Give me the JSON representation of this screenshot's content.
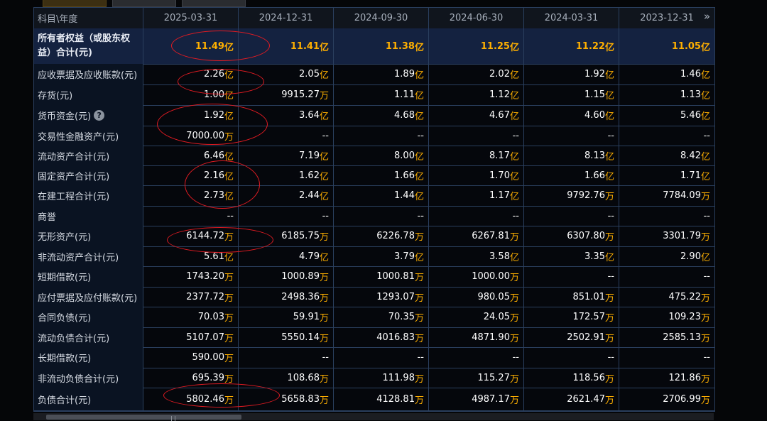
{
  "header": {
    "label": "科目\\年度",
    "periods": [
      "2025-03-31",
      "2024-12-31",
      "2024-09-30",
      "2024-06-30",
      "2024-03-31",
      "2023-12-31"
    ],
    "more_icon": "double-chevron-right-icon"
  },
  "rows": [
    {
      "label": "所有者权益（或股东权益）合计(元)",
      "values": [
        {
          "n": "11.49",
          "u": "亿"
        },
        {
          "n": "11.41",
          "u": "亿"
        },
        {
          "n": "11.38",
          "u": "亿"
        },
        {
          "n": "11.25",
          "u": "亿"
        },
        {
          "n": "11.22",
          "u": "亿"
        },
        {
          "n": "11.05",
          "u": "亿"
        }
      ]
    },
    {
      "label": "应收票据及应收账款(元)",
      "values": [
        {
          "n": "2.26",
          "u": "亿"
        },
        {
          "n": "2.05",
          "u": "亿"
        },
        {
          "n": "1.89",
          "u": "亿"
        },
        {
          "n": "2.02",
          "u": "亿"
        },
        {
          "n": "1.92",
          "u": "亿"
        },
        {
          "n": "1.46",
          "u": "亿"
        }
      ]
    },
    {
      "label": "存货(元)",
      "values": [
        {
          "n": "1.00",
          "u": "亿"
        },
        {
          "n": "9915.27",
          "u": "万"
        },
        {
          "n": "1.11",
          "u": "亿"
        },
        {
          "n": "1.12",
          "u": "亿"
        },
        {
          "n": "1.15",
          "u": "亿"
        },
        {
          "n": "1.13",
          "u": "亿"
        }
      ]
    },
    {
      "label": "货币资金(元)",
      "help": "?",
      "values": [
        {
          "n": "1.92",
          "u": "亿"
        },
        {
          "n": "3.64",
          "u": "亿"
        },
        {
          "n": "4.68",
          "u": "亿"
        },
        {
          "n": "4.67",
          "u": "亿"
        },
        {
          "n": "4.60",
          "u": "亿"
        },
        {
          "n": "5.46",
          "u": "亿"
        }
      ]
    },
    {
      "label": "交易性金融资产(元)",
      "values": [
        {
          "n": "7000.00",
          "u": "万"
        },
        {
          "n": "--",
          "u": ""
        },
        {
          "n": "--",
          "u": ""
        },
        {
          "n": "--",
          "u": ""
        },
        {
          "n": "--",
          "u": ""
        },
        {
          "n": "--",
          "u": ""
        }
      ]
    },
    {
      "label": "流动资产合计(元)",
      "values": [
        {
          "n": "6.46",
          "u": "亿"
        },
        {
          "n": "7.19",
          "u": "亿"
        },
        {
          "n": "8.00",
          "u": "亿"
        },
        {
          "n": "8.17",
          "u": "亿"
        },
        {
          "n": "8.13",
          "u": "亿"
        },
        {
          "n": "8.42",
          "u": "亿"
        }
      ]
    },
    {
      "label": "固定资产合计(元)",
      "values": [
        {
          "n": "2.16",
          "u": "亿"
        },
        {
          "n": "1.62",
          "u": "亿"
        },
        {
          "n": "1.66",
          "u": "亿"
        },
        {
          "n": "1.70",
          "u": "亿"
        },
        {
          "n": "1.66",
          "u": "亿"
        },
        {
          "n": "1.71",
          "u": "亿"
        }
      ]
    },
    {
      "label": "在建工程合计(元)",
      "values": [
        {
          "n": "2.73",
          "u": "亿"
        },
        {
          "n": "2.44",
          "u": "亿"
        },
        {
          "n": "1.44",
          "u": "亿"
        },
        {
          "n": "1.17",
          "u": "亿"
        },
        {
          "n": "9792.76",
          "u": "万"
        },
        {
          "n": "7784.09",
          "u": "万"
        }
      ]
    },
    {
      "label": "商誉",
      "values": [
        {
          "n": "--",
          "u": ""
        },
        {
          "n": "--",
          "u": ""
        },
        {
          "n": "--",
          "u": ""
        },
        {
          "n": "--",
          "u": ""
        },
        {
          "n": "--",
          "u": ""
        },
        {
          "n": "--",
          "u": ""
        }
      ]
    },
    {
      "label": "无形资产(元)",
      "values": [
        {
          "n": "6144.72",
          "u": "万"
        },
        {
          "n": "6185.75",
          "u": "万"
        },
        {
          "n": "6226.78",
          "u": "万"
        },
        {
          "n": "6267.81",
          "u": "万"
        },
        {
          "n": "6307.80",
          "u": "万"
        },
        {
          "n": "3301.79",
          "u": "万"
        }
      ]
    },
    {
      "label": "非流动资产合计(元)",
      "values": [
        {
          "n": "5.61",
          "u": "亿"
        },
        {
          "n": "4.79",
          "u": "亿"
        },
        {
          "n": "3.79",
          "u": "亿"
        },
        {
          "n": "3.58",
          "u": "亿"
        },
        {
          "n": "3.35",
          "u": "亿"
        },
        {
          "n": "2.90",
          "u": "亿"
        }
      ]
    },
    {
      "label": "短期借款(元)",
      "values": [
        {
          "n": "1743.20",
          "u": "万"
        },
        {
          "n": "1000.89",
          "u": "万"
        },
        {
          "n": "1000.81",
          "u": "万"
        },
        {
          "n": "1000.00",
          "u": "万"
        },
        {
          "n": "--",
          "u": ""
        },
        {
          "n": "--",
          "u": ""
        }
      ]
    },
    {
      "label": "应付票据及应付账款(元)",
      "values": [
        {
          "n": "2377.72",
          "u": "万"
        },
        {
          "n": "2498.36",
          "u": "万"
        },
        {
          "n": "1293.07",
          "u": "万"
        },
        {
          "n": "980.05",
          "u": "万"
        },
        {
          "n": "851.01",
          "u": "万"
        },
        {
          "n": "475.22",
          "u": "万"
        }
      ]
    },
    {
      "label": "合同负债(元)",
      "values": [
        {
          "n": "70.03",
          "u": "万"
        },
        {
          "n": "59.91",
          "u": "万"
        },
        {
          "n": "70.35",
          "u": "万"
        },
        {
          "n": "24.05",
          "u": "万"
        },
        {
          "n": "172.57",
          "u": "万"
        },
        {
          "n": "109.23",
          "u": "万"
        }
      ]
    },
    {
      "label": "流动负债合计(元)",
      "values": [
        {
          "n": "5107.07",
          "u": "万"
        },
        {
          "n": "5550.14",
          "u": "万"
        },
        {
          "n": "4016.83",
          "u": "万"
        },
        {
          "n": "4871.90",
          "u": "万"
        },
        {
          "n": "2502.91",
          "u": "万"
        },
        {
          "n": "2585.13",
          "u": "万"
        }
      ]
    },
    {
      "label": "长期借款(元)",
      "values": [
        {
          "n": "590.00",
          "u": "万"
        },
        {
          "n": "--",
          "u": ""
        },
        {
          "n": "--",
          "u": ""
        },
        {
          "n": "--",
          "u": ""
        },
        {
          "n": "--",
          "u": ""
        },
        {
          "n": "--",
          "u": ""
        }
      ]
    },
    {
      "label": "非流动负债合计(元)",
      "values": [
        {
          "n": "695.39",
          "u": "万"
        },
        {
          "n": "108.68",
          "u": "万"
        },
        {
          "n": "111.98",
          "u": "万"
        },
        {
          "n": "115.27",
          "u": "万"
        },
        {
          "n": "118.56",
          "u": "万"
        },
        {
          "n": "121.86",
          "u": "万"
        }
      ]
    },
    {
      "label": "负债合计(元)",
      "values": [
        {
          "n": "5802.46",
          "u": "万"
        },
        {
          "n": "5658.83",
          "u": "万"
        },
        {
          "n": "4128.81",
          "u": "万"
        },
        {
          "n": "4987.17",
          "u": "万"
        },
        {
          "n": "2621.47",
          "u": "万"
        },
        {
          "n": "2706.99",
          "u": "万"
        }
      ]
    }
  ],
  "colors": {
    "accent": "#ffb000",
    "annotation": "#e11b22",
    "grid": "#2a3f5e"
  }
}
